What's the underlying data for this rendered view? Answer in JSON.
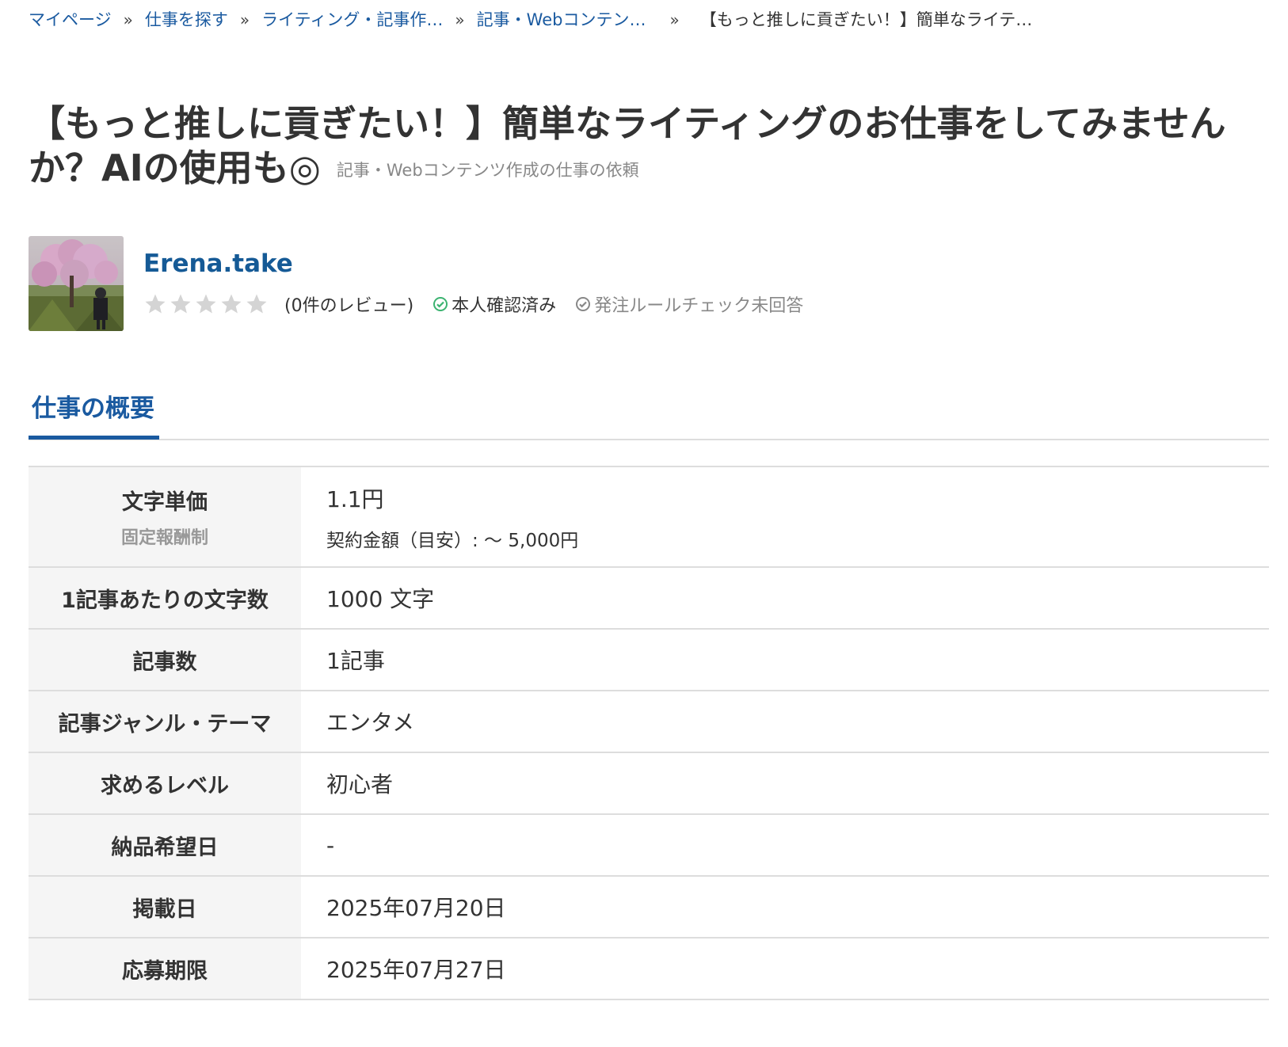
{
  "breadcrumb": {
    "items": [
      "マイページ",
      "仕事を探す",
      "ライティング・記事作…",
      "記事・Webコンテン…"
    ],
    "current": "【もっと推しに貢ぎたい！】簡単なライテ…",
    "separator": "»"
  },
  "job": {
    "title": "【もっと推しに貢ぎたい！】簡単なライティングのお仕事をしてみませんか？AIの使用も◎",
    "category_note": "記事・Webコンテンツ作成の仕事の依頼"
  },
  "client": {
    "name": "Erena.take",
    "rating_stars": 0,
    "max_stars": 5,
    "reviews": "(0件のレビュー)",
    "verified": "本人確認済み",
    "rule_check": "発注ルールチェック未回答",
    "avatar_icon": "photo-avatar"
  },
  "section": {
    "tab": "仕事の概要"
  },
  "details": {
    "price": {
      "label": "文字単価",
      "sublabel": "固定報酬制",
      "value": "1.1円",
      "subvalue": "契約金額（目安）: 〜 5,000円"
    },
    "rows": [
      {
        "label": "1記事あたりの文字数",
        "value": "1000 文字"
      },
      {
        "label": "記事数",
        "value": "1記事"
      },
      {
        "label": "記事ジャンル・テーマ",
        "value": "エンタメ"
      },
      {
        "label": "求めるレベル",
        "value": "初心者"
      },
      {
        "label": "納品希望日",
        "value": "-"
      },
      {
        "label": "掲載日",
        "value": "2025年07月20日"
      },
      {
        "label": "応募期限",
        "value": "2025年07月27日"
      }
    ]
  },
  "colors": {
    "link": "#1a5aa0",
    "client_name": "#155a96",
    "verified_green": "#3cb371",
    "muted": "#888888",
    "table_header_bg": "#f5f5f5"
  }
}
